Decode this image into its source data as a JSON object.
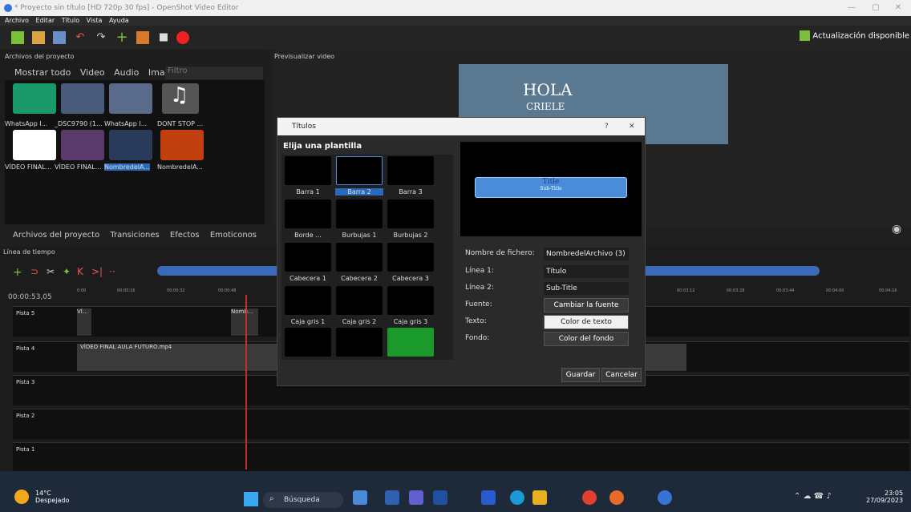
{
  "window": {
    "title": "* Proyecto sin título [HD 720p 30 fps] - OpenShot Video Editor"
  },
  "menu": [
    "Archivo",
    "Editar",
    "Título",
    "Vista",
    "Ayuda"
  ],
  "toolbar": {
    "update_label": "Actualización disponible"
  },
  "project_panel": {
    "title": "Archivos del proyecto",
    "filters": [
      "Mostrar todo",
      "Video",
      "Audio",
      "Imagen"
    ],
    "filter_placeholder": "Filtro",
    "files": [
      {
        "label": "WhatsApp I..."
      },
      {
        "label": "_DSC9790 (1..."
      },
      {
        "label": "WhatsApp I..."
      },
      {
        "label": "DONT STOP ..."
      },
      {
        "label": "VÍDEO FINAL..."
      },
      {
        "label": "VÍDEO FINAL..."
      },
      {
        "label": "NombredelA..."
      },
      {
        "label": "NombredelA..."
      }
    ],
    "tabs": [
      "Archivos del proyecto",
      "Transiciones",
      "Efectos",
      "Emoticonos"
    ]
  },
  "preview": {
    "title": "Previsualizar video",
    "text1": "HOLA",
    "text2": "CRIELE"
  },
  "dialog": {
    "title": "Títulos",
    "subtitle": "Elija una plantilla",
    "templates": [
      "Barra 1",
      "Barra 2",
      "Barra 3",
      "Borde ...",
      "Burbujas 1",
      "Burbujas 2",
      "Cabecera 1",
      "Cabecera 2",
      "Cabecera 3",
      "Caja gris 1",
      "Caja gris 2",
      "Caja gris 3"
    ],
    "preview_title": "Title",
    "preview_sub": "Sub-Title",
    "fields": {
      "filename_label": "Nombre de fichero:",
      "filename": "NombredelArchivo (3)",
      "line1_label": "Línea 1:",
      "line1": "Título",
      "line2_label": "Línea 2:",
      "line2": "Sub-Title",
      "font_label": "Fuente:",
      "font_button": "Cambiar la fuente",
      "text_label": "Texto:",
      "text_button": "Color de texto",
      "bg_label": "Fondo:",
      "bg_button": "Color del fondo"
    },
    "save": "Guardar",
    "cancel": "Cancelar",
    "help": "?",
    "close": "✕"
  },
  "timeline": {
    "title": "Línea de tiempo",
    "time": "00:00:53,05",
    "ticks": [
      "0:00",
      "00:00:16",
      "00:00:32",
      "00:00:48",
      "00:03:12",
      "00:03:28",
      "00:03:44",
      "00:04:00",
      "00:04:16"
    ],
    "tracks": [
      "Pista 5",
      "Pista 4",
      "Pista 3",
      "Pista 2",
      "Pista 1"
    ],
    "clip_pista5a": "VÍ...",
    "clip_pista5b": "Nomb...",
    "clip_pista4": "VÍDEO FINAL AULA FUTURO.mp4"
  },
  "taskbar": {
    "weather_temp": "14°C",
    "weather_desc": "Despejado",
    "search": "Búsqueda",
    "time": "23:05",
    "date": "27/09/2023"
  }
}
